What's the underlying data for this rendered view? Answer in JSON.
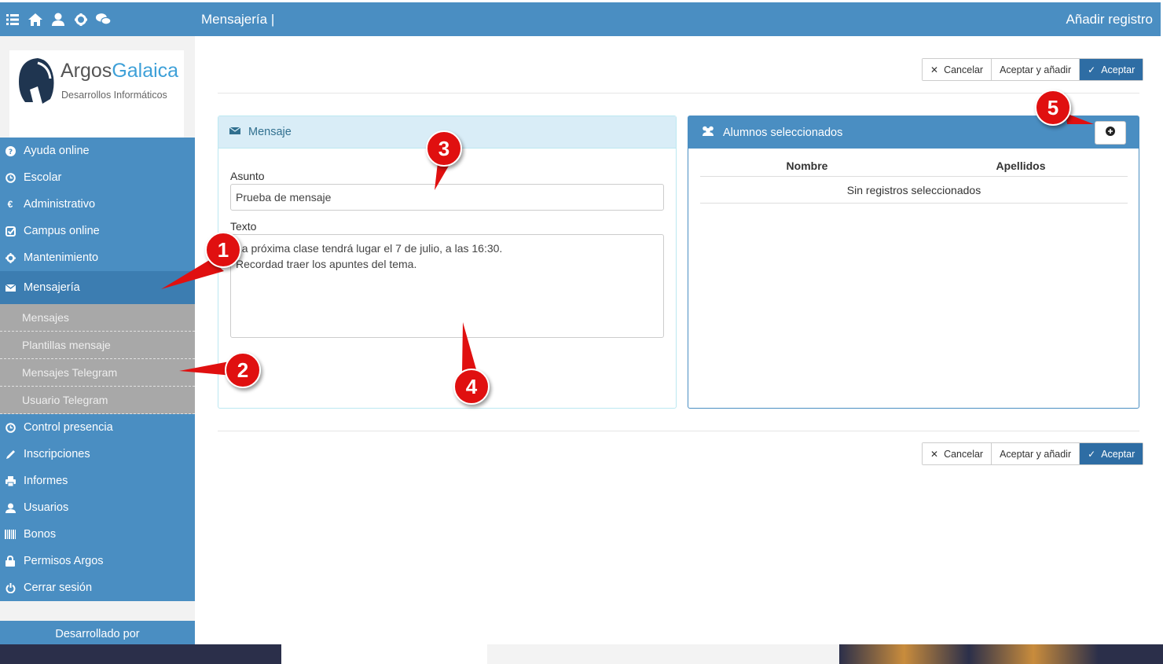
{
  "topbar": {
    "title": "Mensajería |",
    "right": "Añadir registro",
    "icons": [
      "list-icon",
      "home-icon",
      "user-icon",
      "gear-icon",
      "chat-icon"
    ]
  },
  "logo": {
    "brand_a": "Argos",
    "brand_b": "Galaica",
    "sub": "Desarrollos Informáticos"
  },
  "menu": {
    "items_top": [
      {
        "label": "Ayuda online",
        "icon": "question-icon"
      },
      {
        "label": "Escolar",
        "icon": "clock-icon"
      },
      {
        "label": "Administrativo",
        "icon": "euro-icon"
      },
      {
        "label": "Campus online",
        "icon": "check-icon"
      },
      {
        "label": "Mantenimiento",
        "icon": "gear-icon"
      },
      {
        "label": "Mensajería",
        "icon": "envelope-icon"
      }
    ],
    "submenu": [
      "Mensajes",
      "Plantillas mensaje",
      "Mensajes Telegram",
      "Usuario Telegram"
    ],
    "items_bottom": [
      {
        "label": "Control presencia",
        "icon": "clock-icon"
      },
      {
        "label": "Inscripciones",
        "icon": "pencil-icon"
      },
      {
        "label": "Informes",
        "icon": "print-icon"
      },
      {
        "label": "Usuarios",
        "icon": "user-icon"
      },
      {
        "label": "Bonos",
        "icon": "barcode-icon"
      },
      {
        "label": "Permisos Argos",
        "icon": "lock-icon"
      },
      {
        "label": "Cerrar sesión",
        "icon": "power-icon"
      }
    ],
    "dev_by": "Desarrollado por"
  },
  "buttons": {
    "cancel": "Cancelar",
    "accept_add": "Aceptar y añadir",
    "accept": "Aceptar"
  },
  "mensaje": {
    "title": "Mensaje",
    "asunto_label": "Asunto",
    "asunto_value": "Prueba de mensaje",
    "texto_label": "Texto",
    "texto_value": "La próxima clase tendrá lugar el 7 de julio, a las 16:30.\nRecordad traer los apuntes del tema."
  },
  "alumnos": {
    "title": "Alumnos seleccionados",
    "col_nombre": "Nombre",
    "col_apellidos": "Apellidos",
    "empty": "Sin registros seleccionados"
  },
  "callouts": [
    "1",
    "2",
    "3",
    "4",
    "5"
  ],
  "colors": {
    "primary": "#4a8ec2",
    "info_bg": "#d9edf7",
    "callout": "#e01010"
  }
}
